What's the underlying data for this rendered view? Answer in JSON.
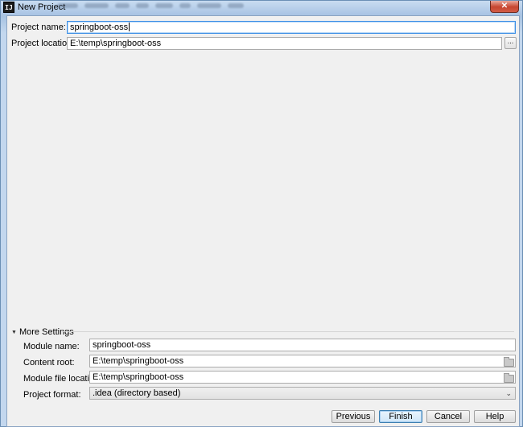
{
  "window": {
    "title": "New Project",
    "app_icon_text": "IJ",
    "close_symbol": "✕"
  },
  "project": {
    "name_label": "Project name:",
    "name_value": "springboot-oss",
    "location_label": "Project location:",
    "location_value": "E:\\temp\\springboot-oss",
    "browse_label": "..."
  },
  "more_settings": {
    "title": "More Settings",
    "toggle_icon": "triangle-down-icon",
    "module_name_label": "Module name:",
    "module_name_value": "springboot-oss",
    "content_root_label": "Content root:",
    "content_root_value": "E:\\temp\\springboot-oss",
    "module_file_label": "Module file location:",
    "module_file_value": "E:\\temp\\springboot-oss",
    "format_label": "Project format:",
    "format_value": ".idea (directory based)"
  },
  "buttons": {
    "previous": "Previous",
    "finish": "Finish",
    "cancel": "Cancel",
    "help": "Help"
  }
}
